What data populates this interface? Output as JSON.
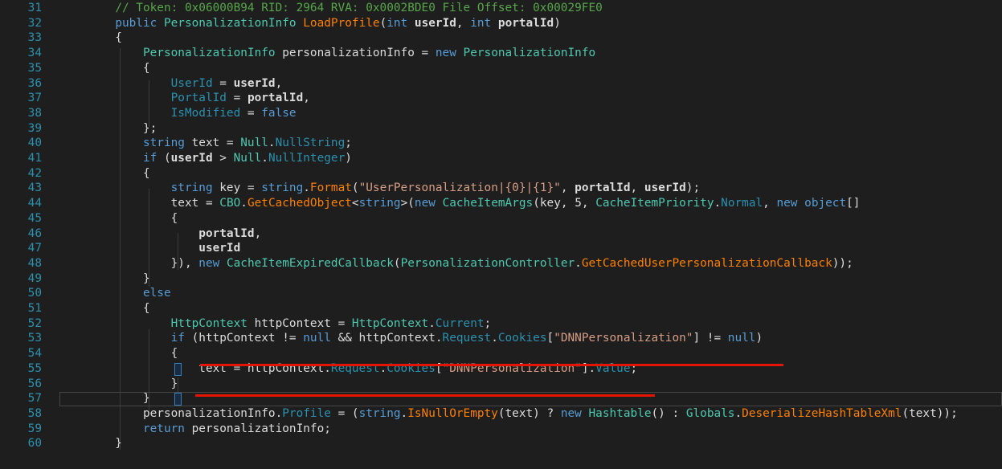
{
  "editor": {
    "lines": [
      {
        "num": "31",
        "tokens": [
          {
            "text": "        ",
            "kind": "plain"
          },
          {
            "text": "// Token: 0x06000B94 RID: 2964 RVA: 0x0002BDE0 File Offset: 0x00029FE0",
            "kind": "comment"
          }
        ]
      },
      {
        "num": "32",
        "tokens": [
          {
            "text": "        ",
            "kind": "plain"
          },
          {
            "text": "public",
            "kind": "keyword"
          },
          {
            "text": " ",
            "kind": "plain"
          },
          {
            "text": "PersonalizationInfo",
            "kind": "type"
          },
          {
            "text": " ",
            "kind": "plain"
          },
          {
            "text": "LoadProfile",
            "kind": "method"
          },
          {
            "text": "(",
            "kind": "plain"
          },
          {
            "text": "int",
            "kind": "keyword"
          },
          {
            "text": " ",
            "kind": "plain"
          },
          {
            "text": "userId",
            "kind": "bold"
          },
          {
            "text": ", ",
            "kind": "plain"
          },
          {
            "text": "int",
            "kind": "keyword"
          },
          {
            "text": " ",
            "kind": "plain"
          },
          {
            "text": "portalId",
            "kind": "bold"
          },
          {
            "text": ")",
            "kind": "plain"
          }
        ]
      },
      {
        "num": "33",
        "tokens": [
          {
            "text": "        {",
            "kind": "plain"
          }
        ]
      },
      {
        "num": "34",
        "tokens": [
          {
            "text": "            ",
            "kind": "plain"
          },
          {
            "text": "PersonalizationInfo",
            "kind": "type"
          },
          {
            "text": " personalizationInfo = ",
            "kind": "plain"
          },
          {
            "text": "new",
            "kind": "keyword"
          },
          {
            "text": " ",
            "kind": "plain"
          },
          {
            "text": "PersonalizationInfo",
            "kind": "type"
          }
        ]
      },
      {
        "num": "35",
        "tokens": [
          {
            "text": "            {",
            "kind": "plain"
          }
        ]
      },
      {
        "num": "36",
        "tokens": [
          {
            "text": "                ",
            "kind": "plain"
          },
          {
            "text": "UserId",
            "kind": "prop"
          },
          {
            "text": " = ",
            "kind": "plain"
          },
          {
            "text": "userId",
            "kind": "bold"
          },
          {
            "text": ",",
            "kind": "plain"
          }
        ]
      },
      {
        "num": "37",
        "tokens": [
          {
            "text": "                ",
            "kind": "plain"
          },
          {
            "text": "PortalId",
            "kind": "prop"
          },
          {
            "text": " = ",
            "kind": "plain"
          },
          {
            "text": "portalId",
            "kind": "bold"
          },
          {
            "text": ",",
            "kind": "plain"
          }
        ]
      },
      {
        "num": "38",
        "tokens": [
          {
            "text": "                ",
            "kind": "plain"
          },
          {
            "text": "IsModified",
            "kind": "prop"
          },
          {
            "text": " = ",
            "kind": "plain"
          },
          {
            "text": "false",
            "kind": "keyword"
          }
        ]
      },
      {
        "num": "39",
        "tokens": [
          {
            "text": "            };",
            "kind": "plain"
          }
        ]
      },
      {
        "num": "40",
        "tokens": [
          {
            "text": "            ",
            "kind": "plain"
          },
          {
            "text": "string",
            "kind": "keyword"
          },
          {
            "text": " text = ",
            "kind": "plain"
          },
          {
            "text": "Null",
            "kind": "type"
          },
          {
            "text": ".",
            "kind": "plain"
          },
          {
            "text": "NullString",
            "kind": "prop"
          },
          {
            "text": ";",
            "kind": "plain"
          }
        ]
      },
      {
        "num": "41",
        "tokens": [
          {
            "text": "            ",
            "kind": "plain"
          },
          {
            "text": "if",
            "kind": "keyword"
          },
          {
            "text": " (",
            "kind": "plain"
          },
          {
            "text": "userId",
            "kind": "bold"
          },
          {
            "text": " > ",
            "kind": "plain"
          },
          {
            "text": "Null",
            "kind": "type"
          },
          {
            "text": ".",
            "kind": "plain"
          },
          {
            "text": "NullInteger",
            "kind": "prop"
          },
          {
            "text": ")",
            "kind": "plain"
          }
        ]
      },
      {
        "num": "42",
        "tokens": [
          {
            "text": "            {",
            "kind": "plain"
          }
        ]
      },
      {
        "num": "43",
        "tokens": [
          {
            "text": "                ",
            "kind": "plain"
          },
          {
            "text": "string",
            "kind": "keyword"
          },
          {
            "text": " key = ",
            "kind": "plain"
          },
          {
            "text": "string",
            "kind": "keyword"
          },
          {
            "text": ".",
            "kind": "plain"
          },
          {
            "text": "Format",
            "kind": "method"
          },
          {
            "text": "(",
            "kind": "plain"
          },
          {
            "text": "\"UserPersonalization|{0}|{1}\"",
            "kind": "string"
          },
          {
            "text": ", ",
            "kind": "plain"
          },
          {
            "text": "portalId",
            "kind": "bold"
          },
          {
            "text": ", ",
            "kind": "plain"
          },
          {
            "text": "userId",
            "kind": "bold"
          },
          {
            "text": ");",
            "kind": "plain"
          }
        ]
      },
      {
        "num": "44",
        "tokens": [
          {
            "text": "                text = ",
            "kind": "plain"
          },
          {
            "text": "CBO",
            "kind": "type"
          },
          {
            "text": ".",
            "kind": "plain"
          },
          {
            "text": "GetCachedObject",
            "kind": "method"
          },
          {
            "text": "<",
            "kind": "plain"
          },
          {
            "text": "string",
            "kind": "keyword"
          },
          {
            "text": ">(",
            "kind": "plain"
          },
          {
            "text": "new",
            "kind": "keyword"
          },
          {
            "text": " ",
            "kind": "plain"
          },
          {
            "text": "CacheItemArgs",
            "kind": "type"
          },
          {
            "text": "(key, 5, ",
            "kind": "plain"
          },
          {
            "text": "CacheItemPriority",
            "kind": "type"
          },
          {
            "text": ".",
            "kind": "plain"
          },
          {
            "text": "Normal",
            "kind": "prop"
          },
          {
            "text": ", ",
            "kind": "plain"
          },
          {
            "text": "new",
            "kind": "keyword"
          },
          {
            "text": " ",
            "kind": "plain"
          },
          {
            "text": "object",
            "kind": "keyword"
          },
          {
            "text": "[]",
            "kind": "plain"
          }
        ]
      },
      {
        "num": "45",
        "tokens": [
          {
            "text": "                {",
            "kind": "plain"
          }
        ]
      },
      {
        "num": "46",
        "tokens": [
          {
            "text": "                    ",
            "kind": "plain"
          },
          {
            "text": "portalId",
            "kind": "bold"
          },
          {
            "text": ",",
            "kind": "plain"
          }
        ]
      },
      {
        "num": "47",
        "tokens": [
          {
            "text": "                    ",
            "kind": "plain"
          },
          {
            "text": "userId",
            "kind": "bold"
          }
        ]
      },
      {
        "num": "48",
        "tokens": [
          {
            "text": "                }), ",
            "kind": "plain"
          },
          {
            "text": "new",
            "kind": "keyword"
          },
          {
            "text": " ",
            "kind": "plain"
          },
          {
            "text": "CacheItemExpiredCallback",
            "kind": "type"
          },
          {
            "text": "(",
            "kind": "plain"
          },
          {
            "text": "PersonalizationController",
            "kind": "type"
          },
          {
            "text": ".",
            "kind": "plain"
          },
          {
            "text": "GetCachedUserPersonalizationCallback",
            "kind": "method"
          },
          {
            "text": "));",
            "kind": "plain"
          }
        ]
      },
      {
        "num": "49",
        "tokens": [
          {
            "text": "            }",
            "kind": "plain"
          }
        ]
      },
      {
        "num": "50",
        "tokens": [
          {
            "text": "            ",
            "kind": "plain"
          },
          {
            "text": "else",
            "kind": "keyword"
          }
        ]
      },
      {
        "num": "51",
        "tokens": [
          {
            "text": "            {",
            "kind": "plain"
          }
        ]
      },
      {
        "num": "52",
        "tokens": [
          {
            "text": "                ",
            "kind": "plain"
          },
          {
            "text": "HttpContext",
            "kind": "type"
          },
          {
            "text": " httpContext = ",
            "kind": "plain"
          },
          {
            "text": "HttpContext",
            "kind": "type"
          },
          {
            "text": ".",
            "kind": "plain"
          },
          {
            "text": "Current",
            "kind": "prop"
          },
          {
            "text": ";",
            "kind": "plain"
          }
        ]
      },
      {
        "num": "53",
        "tokens": [
          {
            "text": "                ",
            "kind": "plain"
          },
          {
            "text": "if",
            "kind": "keyword"
          },
          {
            "text": " (httpContext != ",
            "kind": "plain"
          },
          {
            "text": "null",
            "kind": "keyword"
          },
          {
            "text": " && httpContext.",
            "kind": "plain"
          },
          {
            "text": "Request",
            "kind": "prop"
          },
          {
            "text": ".",
            "kind": "plain"
          },
          {
            "text": "Cookies",
            "kind": "prop"
          },
          {
            "text": "[",
            "kind": "plain"
          },
          {
            "text": "\"DNNPersonalization\"",
            "kind": "string"
          },
          {
            "text": "] != ",
            "kind": "plain"
          },
          {
            "text": "null",
            "kind": "keyword"
          },
          {
            "text": ")",
            "kind": "plain"
          }
        ]
      },
      {
        "num": "54",
        "tokens": [
          {
            "text": "                {",
            "kind": "plain"
          }
        ]
      },
      {
        "num": "55",
        "tokens": [
          {
            "text": "                    text = httpContext.",
            "kind": "plain"
          },
          {
            "text": "Request",
            "kind": "prop"
          },
          {
            "text": ".",
            "kind": "plain"
          },
          {
            "text": "Cookies",
            "kind": "prop"
          },
          {
            "text": "[",
            "kind": "plain"
          },
          {
            "text": "\"DNNPersonalization\"",
            "kind": "string"
          },
          {
            "text": "].",
            "kind": "plain"
          },
          {
            "text": "Value",
            "kind": "prop"
          },
          {
            "text": ";",
            "kind": "plain"
          }
        ]
      },
      {
        "num": "56",
        "tokens": [
          {
            "text": "                }",
            "kind": "plain"
          }
        ]
      },
      {
        "num": "57",
        "tokens": [
          {
            "text": "            }",
            "kind": "plain"
          }
        ]
      },
      {
        "num": "58",
        "tokens": [
          {
            "text": "            personalizationInfo.",
            "kind": "plain"
          },
          {
            "text": "Profile",
            "kind": "prop"
          },
          {
            "text": " = (",
            "kind": "plain"
          },
          {
            "text": "string",
            "kind": "keyword"
          },
          {
            "text": ".",
            "kind": "plain"
          },
          {
            "text": "IsNullOrEmpty",
            "kind": "method"
          },
          {
            "text": "(text) ? ",
            "kind": "plain"
          },
          {
            "text": "new",
            "kind": "keyword"
          },
          {
            "text": " ",
            "kind": "plain"
          },
          {
            "text": "Hashtable",
            "kind": "type"
          },
          {
            "text": "() : ",
            "kind": "plain"
          },
          {
            "text": "Globals",
            "kind": "type"
          },
          {
            "text": ".",
            "kind": "plain"
          },
          {
            "text": "DeserializeHashTableXml",
            "kind": "method"
          },
          {
            "text": "(text));",
            "kind": "plain"
          }
        ]
      },
      {
        "num": "59",
        "tokens": [
          {
            "text": "            ",
            "kind": "plain"
          },
          {
            "text": "return",
            "kind": "keyword"
          },
          {
            "text": " personalizationInfo;",
            "kind": "plain"
          }
        ]
      },
      {
        "num": "60",
        "tokens": [
          {
            "text": "        }",
            "kind": "plain"
          }
        ]
      }
    ]
  },
  "colors": {
    "background": "#1e1e1e",
    "line_number": "#2b91af",
    "comment": "#57a64a",
    "keyword": "#569cd6",
    "type": "#4ec9b0",
    "method": "#ff8000",
    "property": "#2b91af",
    "string": "#d69d85",
    "plain": "#dcdcdc",
    "annotation_underline": "#e51400"
  }
}
